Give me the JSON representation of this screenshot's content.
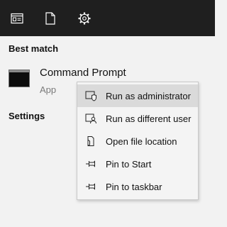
{
  "top_icons": [
    {
      "name": "apps-icon",
      "label": "Apps"
    },
    {
      "name": "documents-icon",
      "label": "Documents"
    },
    {
      "name": "settings-gear-icon",
      "label": "Settings"
    }
  ],
  "sections": {
    "best_match": "Best match",
    "settings": "Settings"
  },
  "result": {
    "title": "Command Prompt",
    "subtitle": "App"
  },
  "context_menu": {
    "items": [
      {
        "label": "Run as administrator",
        "icon": "shield-icon",
        "highlighted": true
      },
      {
        "label": "Run as different user",
        "icon": "user-icon",
        "highlighted": false
      },
      {
        "label": "Open file location",
        "icon": "file-location-icon",
        "highlighted": false
      },
      {
        "label": "Pin to Start",
        "icon": "pin-icon",
        "highlighted": false
      },
      {
        "label": "Pin to taskbar",
        "icon": "pin-icon",
        "highlighted": false
      }
    ]
  },
  "colors": {
    "topbar": "#1f1f1f",
    "background": "#f2f2f2",
    "menu_background": "#f4f4f4",
    "menu_highlight": "#dadada"
  }
}
